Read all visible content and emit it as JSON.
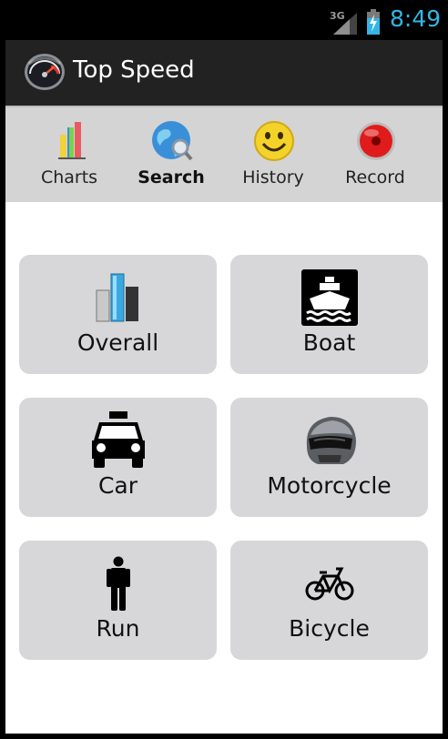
{
  "status_bar": {
    "network": "3G",
    "time": "8:49",
    "signal_icon": "signal-icon",
    "battery_icon": "battery-charging-icon"
  },
  "action_bar": {
    "app_icon": "speedometer-icon",
    "title": "Top Speed"
  },
  "tabs": [
    {
      "label": "Charts",
      "icon": "bar-chart-icon",
      "active": false
    },
    {
      "label": "Search",
      "icon": "globe-search-icon",
      "active": true
    },
    {
      "label": "History",
      "icon": "smiley-icon",
      "active": false
    },
    {
      "label": "Record",
      "icon": "record-icon",
      "active": false
    }
  ],
  "categories": [
    {
      "label": "Overall",
      "icon": "bar-chart-icon"
    },
    {
      "label": "Boat",
      "icon": "ship-icon"
    },
    {
      "label": "Car",
      "icon": "taxi-icon"
    },
    {
      "label": "Motorcycle",
      "icon": "helmet-icon"
    },
    {
      "label": "Run",
      "icon": "person-icon"
    },
    {
      "label": "Bicycle",
      "icon": "bicycle-icon"
    }
  ],
  "colors": {
    "accent": "#33b5e5",
    "action_bar": "#222222",
    "tab_bar": "#d4d4d4",
    "tile": "#d7d6d8"
  }
}
